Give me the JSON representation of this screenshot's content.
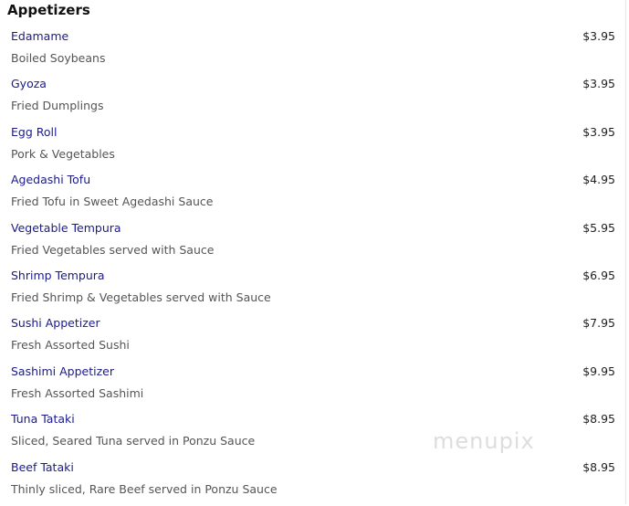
{
  "section": {
    "title": "Appetizers"
  },
  "items": [
    {
      "name": "Edamame",
      "description": "Boiled Soybeans",
      "price": "$3.95"
    },
    {
      "name": "Gyoza",
      "description": "Fried Dumplings",
      "price": "$3.95"
    },
    {
      "name": "Egg Roll",
      "description": "Pork & Vegetables",
      "price": "$3.95"
    },
    {
      "name": "Agedashi Tofu",
      "description": "Fried Tofu in Sweet Agedashi Sauce",
      "price": "$4.95"
    },
    {
      "name": "Vegetable Tempura",
      "description": "Fried Vegetables served with Sauce",
      "price": "$5.95"
    },
    {
      "name": "Shrimp Tempura",
      "description": "Fried Shrimp & Vegetables served with Sauce",
      "price": "$6.95"
    },
    {
      "name": "Sushi Appetizer",
      "description": "Fresh Assorted Sushi",
      "price": "$7.95"
    },
    {
      "name": "Sashimi Appetizer",
      "description": "Fresh Assorted Sashimi",
      "price": "$9.95"
    },
    {
      "name": "Tuna Tataki",
      "description": "Sliced, Seared Tuna served in Ponzu Sauce",
      "price": "$8.95"
    },
    {
      "name": "Beef Tataki",
      "description": "Thinly sliced, Rare Beef served in Ponzu Sauce",
      "price": "$8.95"
    }
  ],
  "watermark": {
    "text": "menupix"
  }
}
